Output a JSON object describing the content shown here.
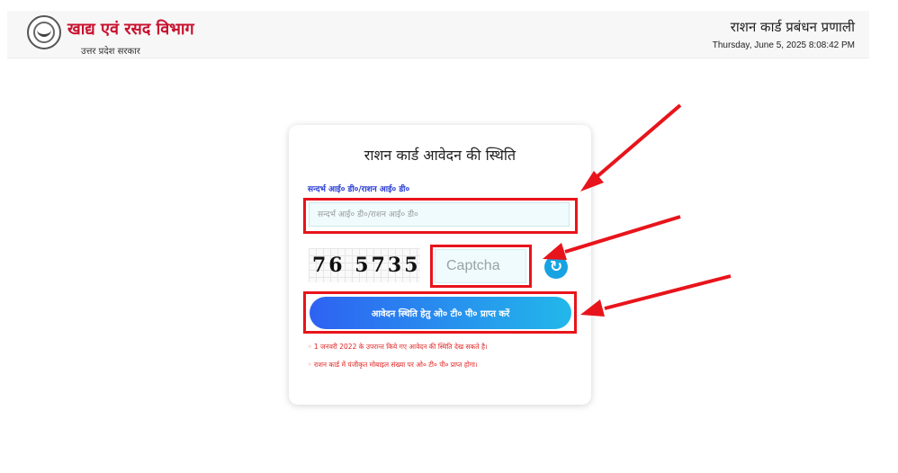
{
  "header": {
    "department": "खाद्य एवं रसद विभाग",
    "government": "उत्तर प्रदेश सरकार",
    "system": "राशन कार्ड प्रबंधन प्रणाली",
    "datetime": "Thursday, June 5, 2025 8:08:42 PM"
  },
  "form": {
    "title": "राशन कार्ड आवेदन की स्थिति",
    "ref_label": "सन्दर्भ आई० डी०/राशन आई० डी०",
    "ref_placeholder": "सन्दर्भ आई० डी०/राशन आई० डी०",
    "ref_value": "",
    "captcha_code": "76 5735",
    "captcha_placeholder": "Captcha",
    "captcha_value": "",
    "submit_label": "आवेदन स्थिति हेतु ओ० टी० पी० प्राप्त करें",
    "notes": [
      "1 जनवरी 2022 के उपरान्त किये गए आवेदन की स्थिति देख सकते है।",
      "राशन कार्ड में पंजीकृत मोबाइल संख्या पर ओ० टी० पी० प्राप्त होगा।"
    ]
  },
  "icons": {
    "logo": "up-government-emblem-icon",
    "refresh": "refresh-icon",
    "annotation_arrow": "red-arrow-icon"
  },
  "colors": {
    "brand_red": "#c8102e",
    "label_blue": "#2b3fd6",
    "button_start": "#2e62f2",
    "button_end": "#22b8ea",
    "highlight_red": "#e8141b"
  }
}
